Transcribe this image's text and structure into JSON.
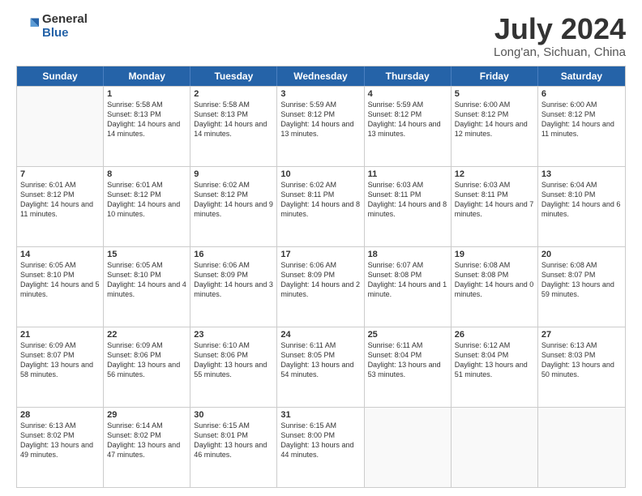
{
  "header": {
    "logo": {
      "line1": "General",
      "line2": "Blue"
    },
    "title": "July 2024",
    "location": "Long'an, Sichuan, China"
  },
  "days_of_week": [
    "Sunday",
    "Monday",
    "Tuesday",
    "Wednesday",
    "Thursday",
    "Friday",
    "Saturday"
  ],
  "weeks": [
    [
      {
        "day": "",
        "empty": true
      },
      {
        "day": "1",
        "sunrise": "Sunrise: 5:58 AM",
        "sunset": "Sunset: 8:13 PM",
        "daylight": "Daylight: 14 hours and 14 minutes."
      },
      {
        "day": "2",
        "sunrise": "Sunrise: 5:58 AM",
        "sunset": "Sunset: 8:13 PM",
        "daylight": "Daylight: 14 hours and 14 minutes."
      },
      {
        "day": "3",
        "sunrise": "Sunrise: 5:59 AM",
        "sunset": "Sunset: 8:12 PM",
        "daylight": "Daylight: 14 hours and 13 minutes."
      },
      {
        "day": "4",
        "sunrise": "Sunrise: 5:59 AM",
        "sunset": "Sunset: 8:12 PM",
        "daylight": "Daylight: 14 hours and 13 minutes."
      },
      {
        "day": "5",
        "sunrise": "Sunrise: 6:00 AM",
        "sunset": "Sunset: 8:12 PM",
        "daylight": "Daylight: 14 hours and 12 minutes."
      },
      {
        "day": "6",
        "sunrise": "Sunrise: 6:00 AM",
        "sunset": "Sunset: 8:12 PM",
        "daylight": "Daylight: 14 hours and 11 minutes."
      }
    ],
    [
      {
        "day": "7",
        "sunrise": "Sunrise: 6:01 AM",
        "sunset": "Sunset: 8:12 PM",
        "daylight": "Daylight: 14 hours and 11 minutes."
      },
      {
        "day": "8",
        "sunrise": "Sunrise: 6:01 AM",
        "sunset": "Sunset: 8:12 PM",
        "daylight": "Daylight: 14 hours and 10 minutes."
      },
      {
        "day": "9",
        "sunrise": "Sunrise: 6:02 AM",
        "sunset": "Sunset: 8:12 PM",
        "daylight": "Daylight: 14 hours and 9 minutes."
      },
      {
        "day": "10",
        "sunrise": "Sunrise: 6:02 AM",
        "sunset": "Sunset: 8:11 PM",
        "daylight": "Daylight: 14 hours and 8 minutes."
      },
      {
        "day": "11",
        "sunrise": "Sunrise: 6:03 AM",
        "sunset": "Sunset: 8:11 PM",
        "daylight": "Daylight: 14 hours and 8 minutes."
      },
      {
        "day": "12",
        "sunrise": "Sunrise: 6:03 AM",
        "sunset": "Sunset: 8:11 PM",
        "daylight": "Daylight: 14 hours and 7 minutes."
      },
      {
        "day": "13",
        "sunrise": "Sunrise: 6:04 AM",
        "sunset": "Sunset: 8:10 PM",
        "daylight": "Daylight: 14 hours and 6 minutes."
      }
    ],
    [
      {
        "day": "14",
        "sunrise": "Sunrise: 6:05 AM",
        "sunset": "Sunset: 8:10 PM",
        "daylight": "Daylight: 14 hours and 5 minutes."
      },
      {
        "day": "15",
        "sunrise": "Sunrise: 6:05 AM",
        "sunset": "Sunset: 8:10 PM",
        "daylight": "Daylight: 14 hours and 4 minutes."
      },
      {
        "day": "16",
        "sunrise": "Sunrise: 6:06 AM",
        "sunset": "Sunset: 8:09 PM",
        "daylight": "Daylight: 14 hours and 3 minutes."
      },
      {
        "day": "17",
        "sunrise": "Sunrise: 6:06 AM",
        "sunset": "Sunset: 8:09 PM",
        "daylight": "Daylight: 14 hours and 2 minutes."
      },
      {
        "day": "18",
        "sunrise": "Sunrise: 6:07 AM",
        "sunset": "Sunset: 8:08 PM",
        "daylight": "Daylight: 14 hours and 1 minute."
      },
      {
        "day": "19",
        "sunrise": "Sunrise: 6:08 AM",
        "sunset": "Sunset: 8:08 PM",
        "daylight": "Daylight: 14 hours and 0 minutes."
      },
      {
        "day": "20",
        "sunrise": "Sunrise: 6:08 AM",
        "sunset": "Sunset: 8:07 PM",
        "daylight": "Daylight: 13 hours and 59 minutes."
      }
    ],
    [
      {
        "day": "21",
        "sunrise": "Sunrise: 6:09 AM",
        "sunset": "Sunset: 8:07 PM",
        "daylight": "Daylight: 13 hours and 58 minutes."
      },
      {
        "day": "22",
        "sunrise": "Sunrise: 6:09 AM",
        "sunset": "Sunset: 8:06 PM",
        "daylight": "Daylight: 13 hours and 56 minutes."
      },
      {
        "day": "23",
        "sunrise": "Sunrise: 6:10 AM",
        "sunset": "Sunset: 8:06 PM",
        "daylight": "Daylight: 13 hours and 55 minutes."
      },
      {
        "day": "24",
        "sunrise": "Sunrise: 6:11 AM",
        "sunset": "Sunset: 8:05 PM",
        "daylight": "Daylight: 13 hours and 54 minutes."
      },
      {
        "day": "25",
        "sunrise": "Sunrise: 6:11 AM",
        "sunset": "Sunset: 8:04 PM",
        "daylight": "Daylight: 13 hours and 53 minutes."
      },
      {
        "day": "26",
        "sunrise": "Sunrise: 6:12 AM",
        "sunset": "Sunset: 8:04 PM",
        "daylight": "Daylight: 13 hours and 51 minutes."
      },
      {
        "day": "27",
        "sunrise": "Sunrise: 6:13 AM",
        "sunset": "Sunset: 8:03 PM",
        "daylight": "Daylight: 13 hours and 50 minutes."
      }
    ],
    [
      {
        "day": "28",
        "sunrise": "Sunrise: 6:13 AM",
        "sunset": "Sunset: 8:02 PM",
        "daylight": "Daylight: 13 hours and 49 minutes."
      },
      {
        "day": "29",
        "sunrise": "Sunrise: 6:14 AM",
        "sunset": "Sunset: 8:02 PM",
        "daylight": "Daylight: 13 hours and 47 minutes."
      },
      {
        "day": "30",
        "sunrise": "Sunrise: 6:15 AM",
        "sunset": "Sunset: 8:01 PM",
        "daylight": "Daylight: 13 hours and 46 minutes."
      },
      {
        "day": "31",
        "sunrise": "Sunrise: 6:15 AM",
        "sunset": "Sunset: 8:00 PM",
        "daylight": "Daylight: 13 hours and 44 minutes."
      },
      {
        "day": "",
        "empty": true
      },
      {
        "day": "",
        "empty": true
      },
      {
        "day": "",
        "empty": true
      }
    ]
  ]
}
